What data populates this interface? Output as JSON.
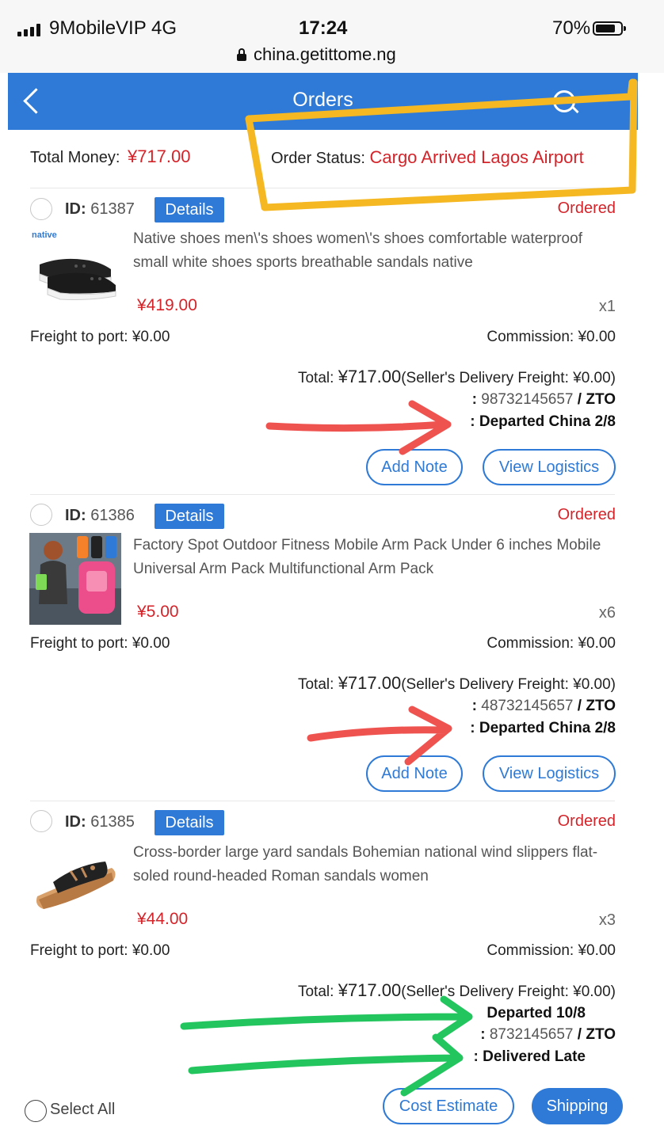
{
  "status_bar": {
    "carrier": "9MobileVIP  4G",
    "time": "17:24",
    "battery": "70%",
    "url": "china.getittome.ng"
  },
  "nav": {
    "title": "Orders"
  },
  "summary": {
    "total_money_label": "Total Money:",
    "total_money": "¥717.00",
    "order_status_label": "Order Status:",
    "order_status": "Cargo Arrived Lagos Airport"
  },
  "orders": [
    {
      "id_label": "ID:",
      "id": "61387",
      "details_label": "Details",
      "status": "Ordered",
      "title": "Native shoes men\\'s shoes women\\'s shoes comfortable waterproof small white shoes sports breathable sandals native",
      "image_label": "native",
      "price": "¥419.00",
      "qty": "x1",
      "freight": "Freight to port: ¥0.00",
      "commission": "Commission: ¥0.00",
      "total_prefix": "Total: ",
      "total_amount": "¥717.00",
      "total_suffix": "(Seller's Delivery Freight: ¥0.00)",
      "tracking": "98732145657",
      "carrier": "/ ZTO",
      "logistics_status": "Departed China 2/8",
      "add_note": "Add Note",
      "view_logistics": "View Logistics"
    },
    {
      "id_label": "ID:",
      "id": "61386",
      "details_label": "Details",
      "status": "Ordered",
      "title": "Factory Spot Outdoor Fitness Mobile Arm Pack Under 6 inches Mobile Universal Arm Pack Multifunctional Arm Pack",
      "price": "¥5.00",
      "qty": "x6",
      "freight": "Freight to port: ¥0.00",
      "commission": "Commission: ¥0.00",
      "total_prefix": "Total: ",
      "total_amount": "¥717.00",
      "total_suffix": "(Seller's Delivery Freight: ¥0.00)",
      "tracking": "48732145657",
      "carrier": "/ ZTO",
      "logistics_status": "Departed China 2/8",
      "add_note": "Add Note",
      "view_logistics": "View Logistics"
    },
    {
      "id_label": "ID:",
      "id": "61385",
      "details_label": "Details",
      "status": "Ordered",
      "title": "Cross-border large yard sandals Bohemian national wind slippers flat-soled round-headed Roman sandals women",
      "price": "¥44.00",
      "qty": "x3",
      "freight": "Freight to port: ¥0.00",
      "commission": "Commission: ¥0.00",
      "total_prefix": "Total: ",
      "total_amount": "¥717.00",
      "total_suffix": "(Seller's Delivery Freight: ¥0.00)",
      "departed": "Departed 10/8",
      "tracking": "8732145657",
      "carrier": "/ ZTO",
      "logistics_status": "Delivered Late"
    }
  ],
  "bottom_bar": {
    "select_all": "Select All",
    "cost_estimate": "Cost Estimate",
    "shipping": "Shipping"
  },
  "colors": {
    "brand_blue": "#2e7ad6",
    "price_red": "#d4242a",
    "annotation_yellow": "#f5b722",
    "annotation_red": "#ef5350",
    "annotation_green": "#22c55e"
  }
}
